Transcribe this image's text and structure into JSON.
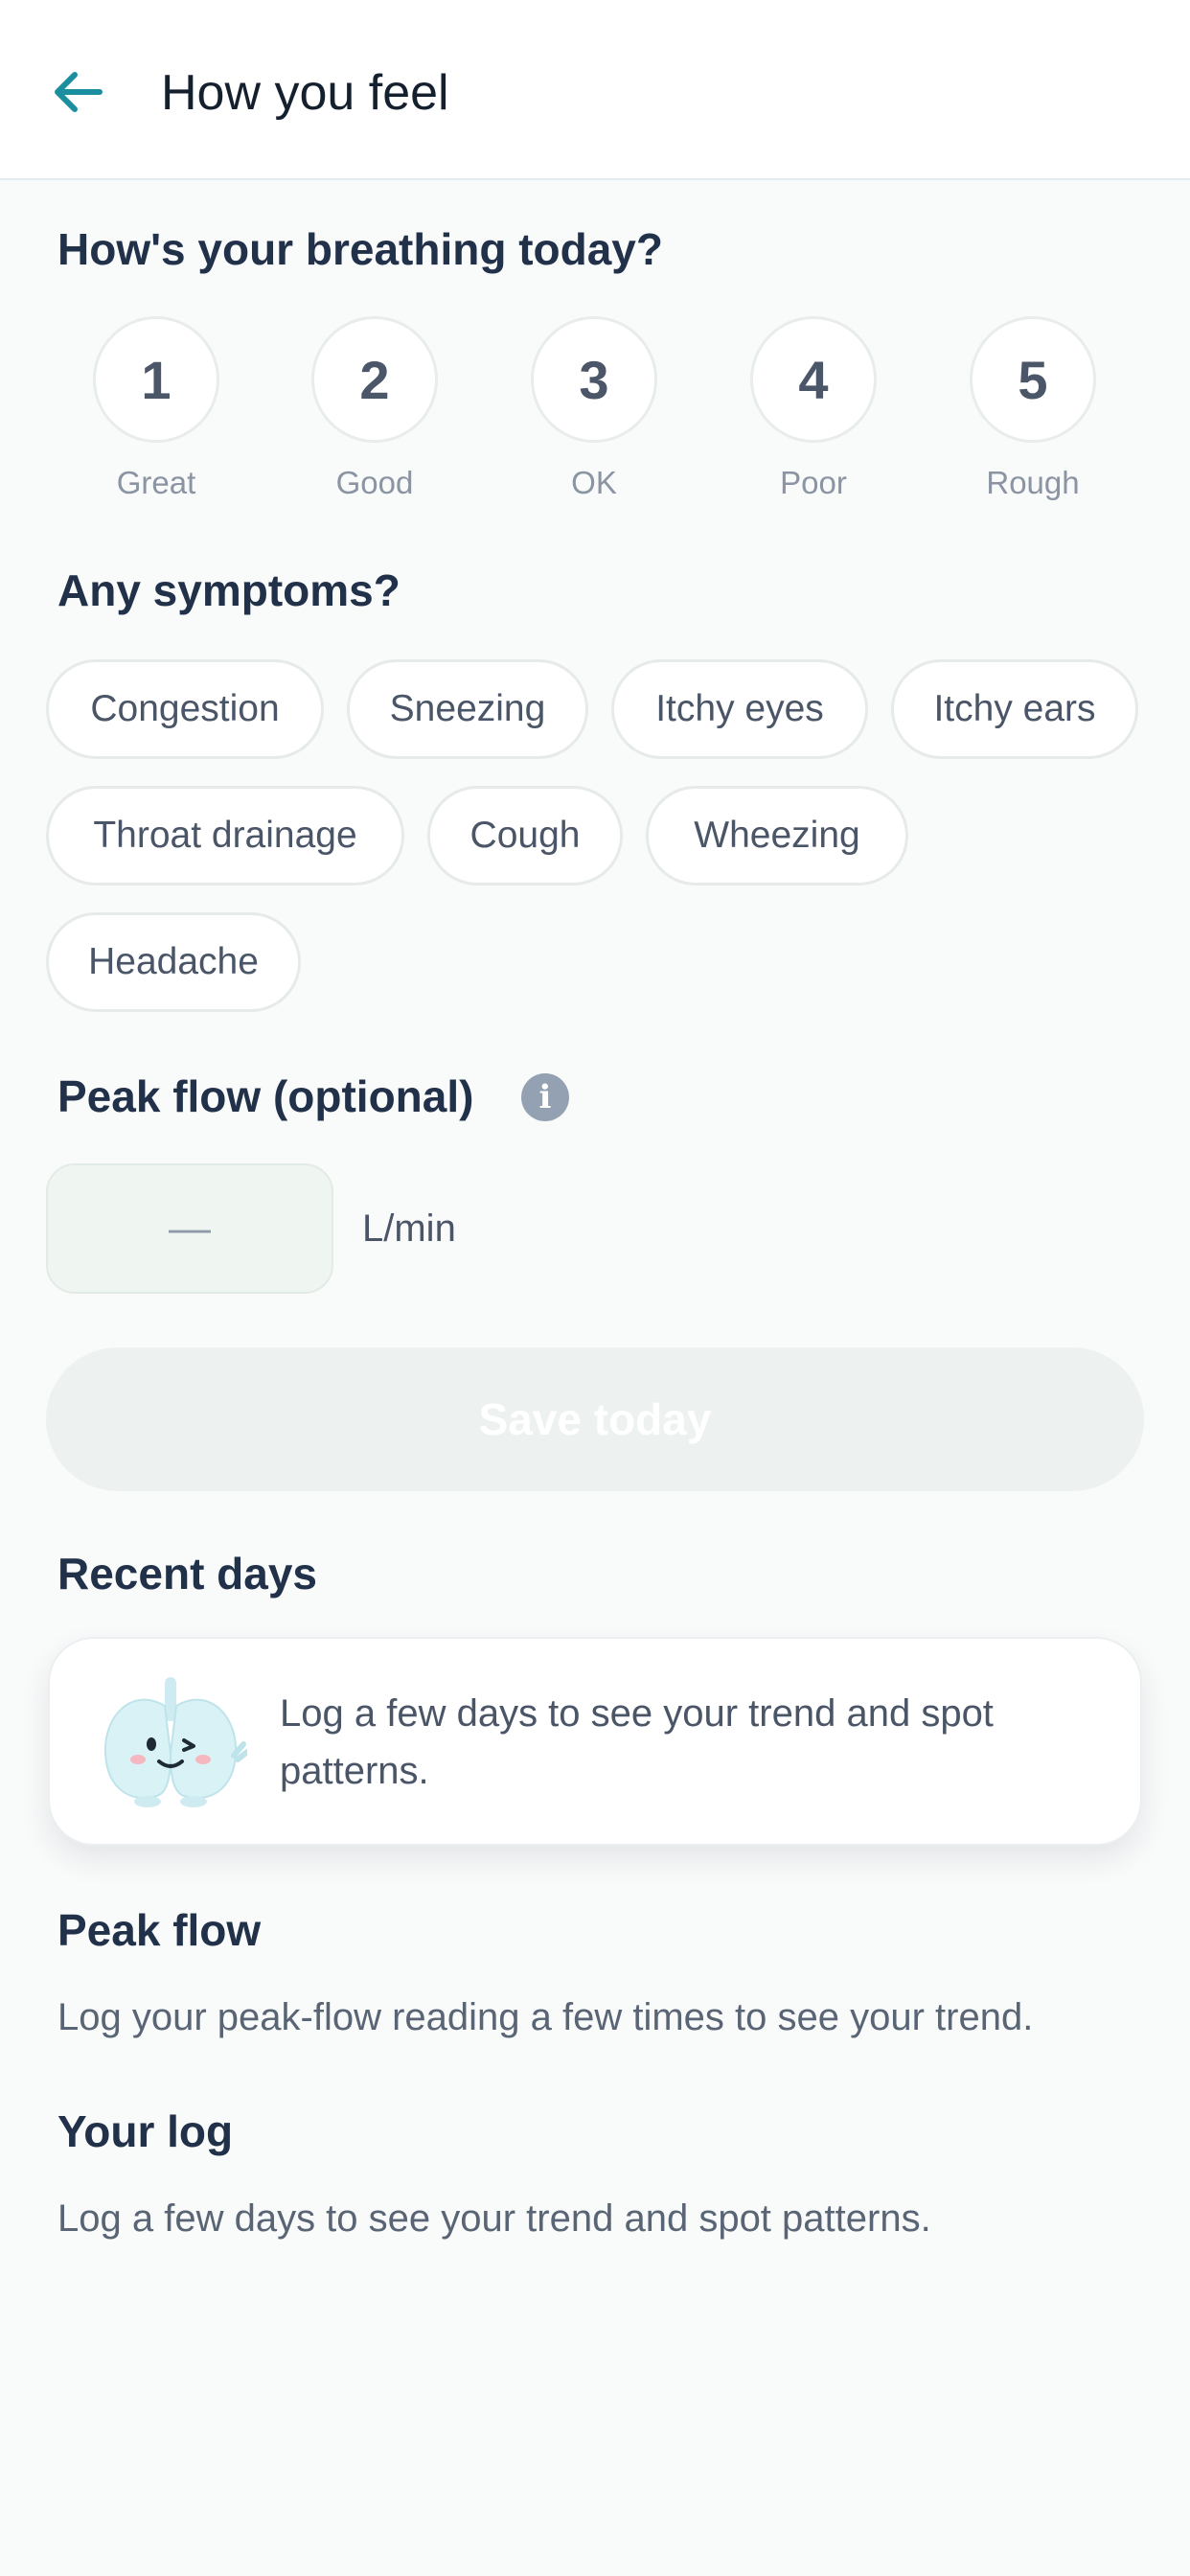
{
  "header": {
    "back_icon": "arrow-left-icon",
    "title": "How you feel"
  },
  "breathing": {
    "title": "How's your breathing today?",
    "options": [
      {
        "value": "1",
        "label": "Great"
      },
      {
        "value": "2",
        "label": "Good"
      },
      {
        "value": "3",
        "label": "OK"
      },
      {
        "value": "4",
        "label": "Poor"
      },
      {
        "value": "5",
        "label": "Rough"
      }
    ]
  },
  "symptoms": {
    "title": "Any symptoms?",
    "chips": [
      "Congestion",
      "Sneezing",
      "Itchy eyes",
      "Itchy ears",
      "Throat drainage",
      "Cough",
      "Wheezing",
      "Headache"
    ]
  },
  "peak_flow_input": {
    "title": "Peak flow (optional)",
    "info_icon": "info-icon",
    "info_glyph": "i",
    "value": "—",
    "unit": "L/min"
  },
  "save_button": {
    "label": "Save today"
  },
  "recent_days": {
    "title": "Recent days",
    "mascot_icon": "lungs-mascot-icon",
    "empty_message": "Log a few days to see your trend and spot patterns."
  },
  "peak_flow_section": {
    "title": "Peak flow",
    "message": "Log your peak-flow reading a few times to see your trend."
  },
  "your_log": {
    "title": "Your log",
    "message": "Log a few days to see your trend and spot patterns."
  },
  "colors": {
    "accent": "#1a8fa0",
    "background": "#f9fafa",
    "heading": "#22314a",
    "save_disabled": "#edf1f0"
  }
}
